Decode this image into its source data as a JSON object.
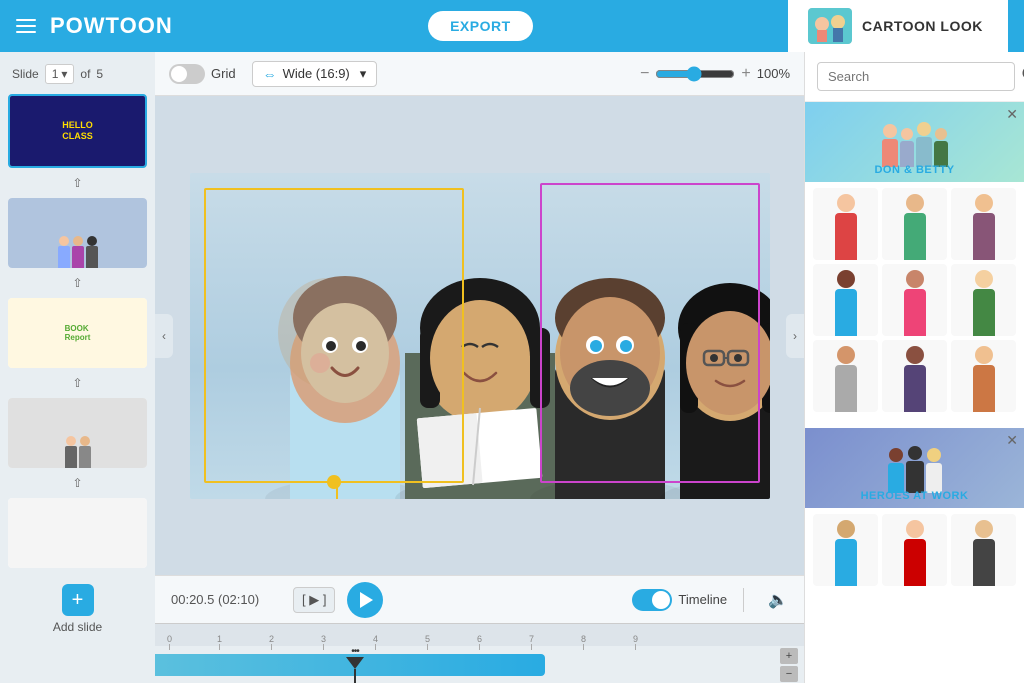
{
  "app": {
    "title": "POWTOON",
    "export_label": "EXPORT",
    "cartoon_look_label": "CARTOON LOOK"
  },
  "toolbar": {
    "grid_label": "Grid",
    "aspect_label": "Wide (16:9)",
    "zoom_value": "100%",
    "zoom_percent": 100
  },
  "slides": {
    "current": 1,
    "total": 5,
    "slide_label": "Slide",
    "of_label": "of"
  },
  "playback": {
    "time_current": "00:20.5",
    "time_total": "(02:10)",
    "step_label": "[ ▶ ]",
    "timeline_label": "Timeline"
  },
  "search": {
    "placeholder": "Search",
    "label": "Search"
  },
  "right_panel": {
    "groups": [
      {
        "id": "don-betty",
        "label": "DON & BETTY",
        "banner_color": "teal"
      },
      {
        "id": "heroes-at-work",
        "label": "HEROES AT WORK",
        "banner_color": "blue"
      }
    ]
  },
  "add_slide": {
    "label": "Add slide"
  },
  "timeline": {
    "markers": [
      "0",
      "1",
      "2",
      "3",
      "4",
      "5",
      "6",
      "7",
      "8",
      "9"
    ],
    "plus_label": "+",
    "minus_label": "-"
  }
}
